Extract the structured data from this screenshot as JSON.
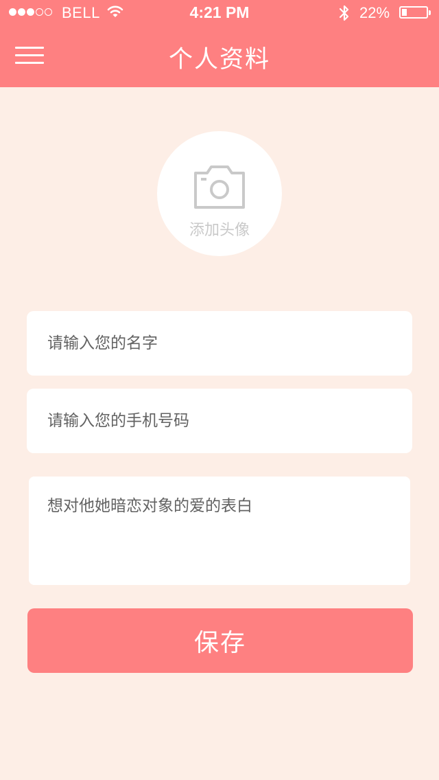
{
  "status_bar": {
    "carrier": "BELL",
    "time": "4:21 PM",
    "battery_percent": "22%",
    "battery_level": 0.22,
    "signal_bars_filled": 3,
    "signal_bars_total": 5,
    "icons": [
      "wifi-icon",
      "bluetooth-icon",
      "battery-icon"
    ]
  },
  "header": {
    "title": "个人资料",
    "menu_icon": "hamburger-menu-icon",
    "background_color": "#fe8081"
  },
  "avatar": {
    "label": "添加头像",
    "icon": "camera-icon"
  },
  "form": {
    "name_placeholder": "请输入您的名字",
    "name_value": "",
    "phone_placeholder": "请输入您的手机号码",
    "phone_value": "",
    "confession_placeholder": "想对他她暗恋对象的爱的表白",
    "confession_value": ""
  },
  "save_button": {
    "label": "保存"
  },
  "colors": {
    "accent": "#fe8081",
    "page_background": "#fdeee6",
    "card_background": "#ffffff"
  }
}
